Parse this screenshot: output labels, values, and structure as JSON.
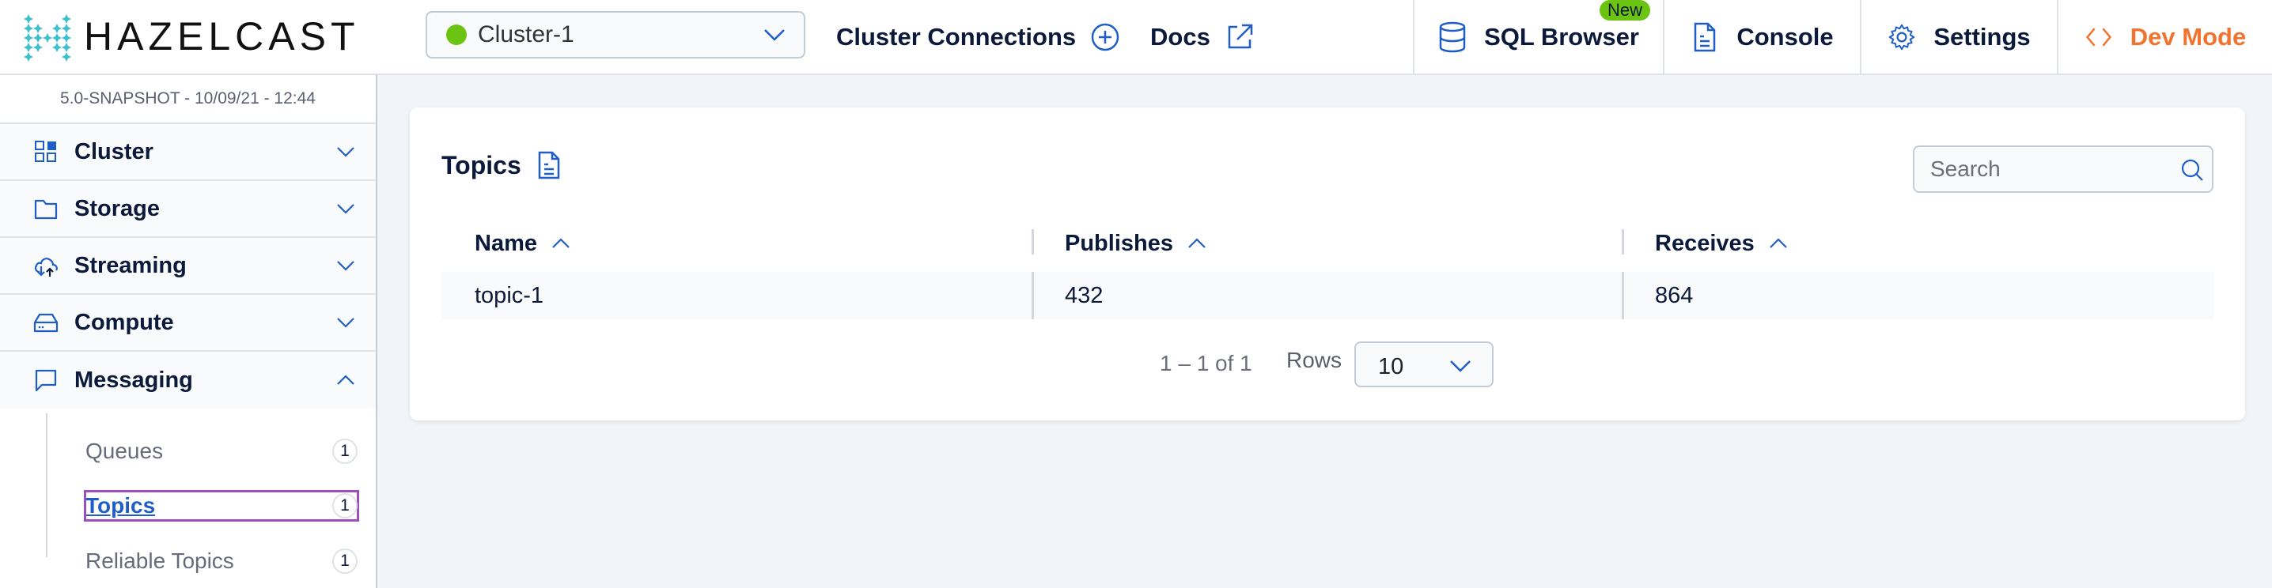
{
  "header": {
    "logo_text": "HAZELCAST",
    "cluster_selector": {
      "value": "Cluster-1",
      "status": "connected",
      "status_color": "#6cc412"
    },
    "cluster_connections_label": "Cluster Connections",
    "docs_label": "Docs",
    "tabs": [
      {
        "label": "SQL Browser",
        "icon": "database-icon",
        "badge": "New"
      },
      {
        "label": "Console",
        "icon": "document-icon"
      },
      {
        "label": "Settings",
        "icon": "gear-icon"
      },
      {
        "label": "Dev Mode",
        "icon": "code-icon"
      }
    ]
  },
  "colors": {
    "accent": "#1f5ec7",
    "dev_mode": "#f07430",
    "badge_green": "#6cc412",
    "text_dark": "#0b1a3a",
    "active_outline": "#9b4fc0"
  },
  "sidebar": {
    "version": "5.0-SNAPSHOT - 10/09/21 - 12:44",
    "sections": [
      {
        "label": "Cluster",
        "icon": "dashboard-grid-icon",
        "expanded": false
      },
      {
        "label": "Storage",
        "icon": "folder-icon",
        "expanded": false
      },
      {
        "label": "Streaming",
        "icon": "cloud-sync-icon",
        "expanded": false
      },
      {
        "label": "Compute",
        "icon": "server-drive-icon",
        "expanded": false
      },
      {
        "label": "Messaging",
        "icon": "chat-bubble-icon",
        "expanded": true
      }
    ],
    "messaging_items": [
      {
        "label": "Queues",
        "count": "1",
        "active": false
      },
      {
        "label": "Topics",
        "count": "1",
        "active": true
      },
      {
        "label": "Reliable Topics",
        "count": "1",
        "active": false
      }
    ]
  },
  "main": {
    "title": "Topics",
    "search": {
      "placeholder": "Search",
      "value": ""
    },
    "table": {
      "columns": [
        {
          "label": "Name",
          "sort": "ascending"
        },
        {
          "label": "Publishes",
          "sort": "ascending"
        },
        {
          "label": "Receives",
          "sort": "ascending"
        }
      ],
      "rows": [
        {
          "name": "topic-1",
          "publishes": "432",
          "receives": "864"
        }
      ]
    },
    "pagination": {
      "range": "1 – 1 of 1",
      "rows_label": "Rows",
      "rows_per_page": "10"
    }
  }
}
